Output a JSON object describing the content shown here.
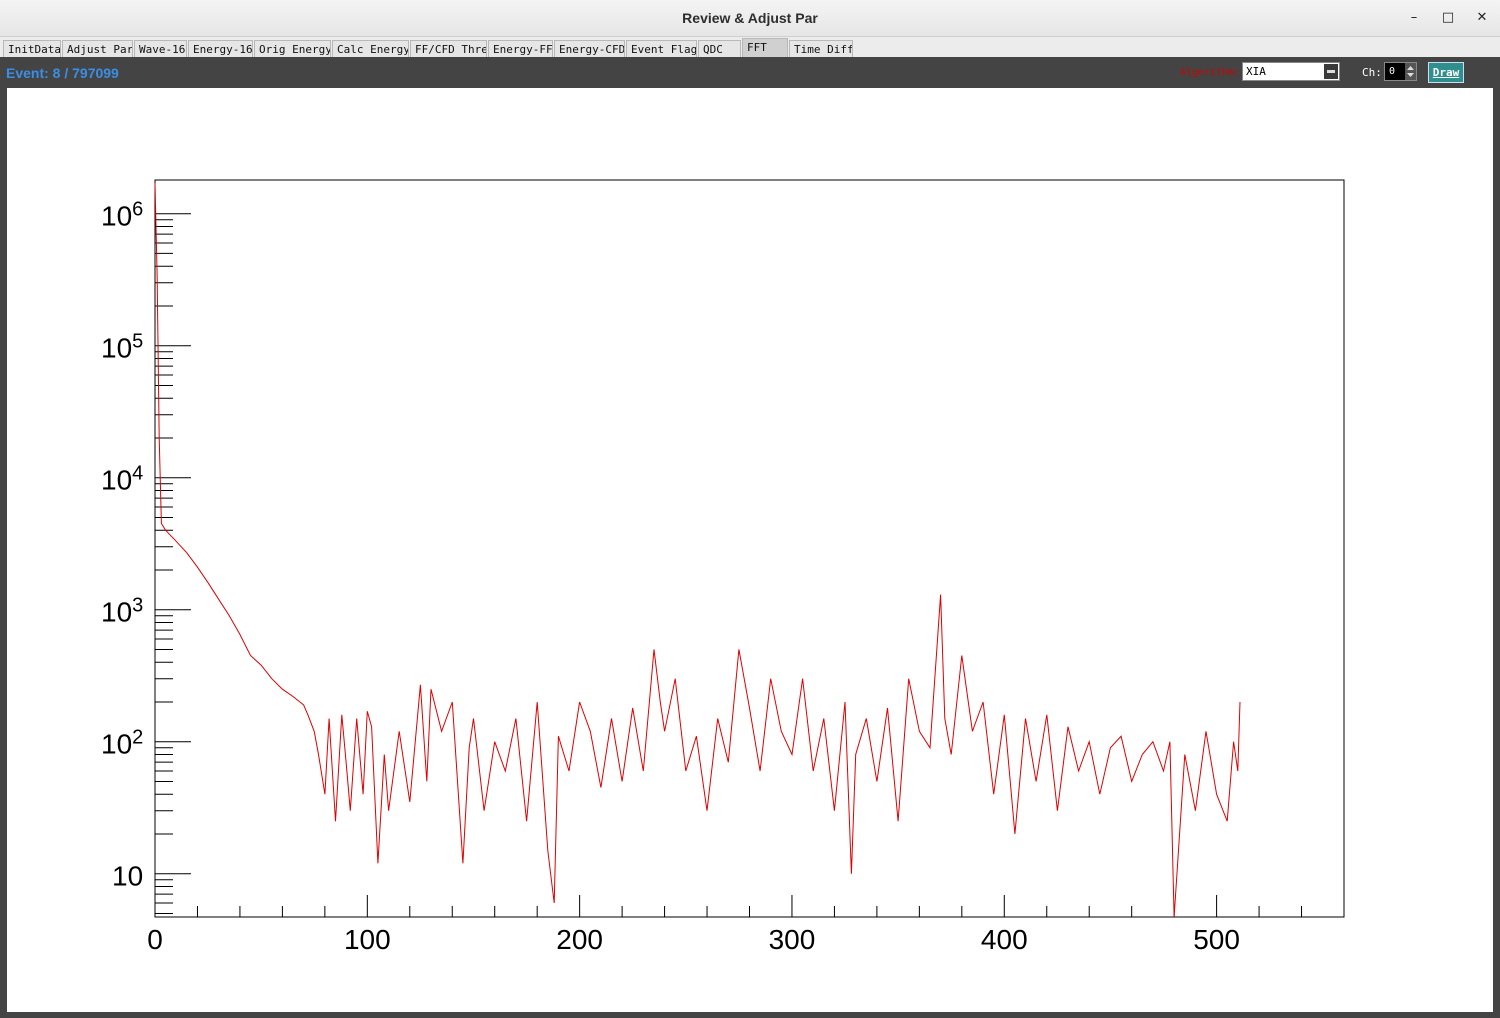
{
  "window": {
    "title": "Review & Adjust Par",
    "minimize": "–",
    "maximize": "□",
    "close": "✕"
  },
  "tabs": [
    {
      "label": "InitData"
    },
    {
      "label": "Adjust Par"
    },
    {
      "label": "Wave-16"
    },
    {
      "label": "Energy-16"
    },
    {
      "label": "Orig Energy"
    },
    {
      "label": "Calc Energy"
    },
    {
      "label": "FF/CFD Thre"
    },
    {
      "label": "Energy-FF"
    },
    {
      "label": "Energy-CFD"
    },
    {
      "label": "Event Flag"
    },
    {
      "label": "QDC"
    },
    {
      "label": "FFT",
      "active": true
    },
    {
      "label": "Time Diff"
    }
  ],
  "toolbar": {
    "event_text": "Event: 8 / 797099",
    "algorithm_label": "Algorithm:",
    "algorithm_value": "XIA",
    "ch_label": "Ch:",
    "ch_value": "0",
    "draw_label": "Draw"
  },
  "colors": {
    "line": "#e00000",
    "event_text": "#3a8ee6",
    "draw_button": "#2f8f8f",
    "panel": "#444444"
  },
  "chart_data": {
    "type": "line",
    "title": "",
    "xlabel": "",
    "ylabel": "",
    "xlim": [
      0,
      560
    ],
    "ylim": [
      4.7,
      1800000
    ],
    "yscale": "log",
    "grid": false,
    "x_ticks": [
      0,
      100,
      200,
      300,
      400,
      500
    ],
    "y_ticks": [
      {
        "value": 10,
        "base": "10",
        "exp": ""
      },
      {
        "value": 100,
        "base": "10",
        "exp": "2"
      },
      {
        "value": 1000,
        "base": "10",
        "exp": "3"
      },
      {
        "value": 10000,
        "base": "10",
        "exp": "4"
      },
      {
        "value": 100000,
        "base": "10",
        "exp": "5"
      },
      {
        "value": 1000000,
        "base": "10",
        "exp": "6"
      }
    ],
    "series": [
      {
        "color": "#e00000",
        "x": [
          0,
          1,
          2,
          3,
          5,
          10,
          15,
          20,
          25,
          30,
          35,
          40,
          45,
          50,
          55,
          60,
          65,
          70,
          72,
          75,
          77,
          80,
          82,
          85,
          88,
          90,
          92,
          95,
          98,
          100,
          102,
          105,
          108,
          110,
          115,
          120,
          125,
          128,
          130,
          135,
          140,
          145,
          148,
          150,
          155,
          160,
          165,
          170,
          175,
          180,
          185,
          188,
          190,
          195,
          200,
          205,
          210,
          215,
          220,
          225,
          230,
          235,
          238,
          240,
          245,
          250,
          255,
          260,
          265,
          270,
          275,
          280,
          285,
          290,
          295,
          300,
          305,
          310,
          315,
          320,
          325,
          328,
          330,
          335,
          340,
          345,
          350,
          355,
          360,
          365,
          370,
          372,
          375,
          380,
          385,
          390,
          395,
          400,
          405,
          410,
          415,
          420,
          425,
          430,
          435,
          440,
          445,
          450,
          455,
          460,
          465,
          470,
          475,
          478,
          480,
          485,
          490,
          495,
          500,
          505,
          508,
          510,
          511
        ],
        "y": [
          1700000,
          350000,
          20000,
          4500,
          4000,
          3300,
          2700,
          2100,
          1600,
          1200,
          900,
          650,
          450,
          380,
          300,
          250,
          220,
          190,
          160,
          120,
          80,
          40,
          150,
          25,
          160,
          70,
          30,
          150,
          40,
          170,
          130,
          12,
          80,
          30,
          120,
          35,
          270,
          50,
          250,
          120,
          200,
          12,
          90,
          150,
          30,
          100,
          60,
          150,
          25,
          200,
          15,
          6,
          110,
          60,
          200,
          120,
          45,
          150,
          50,
          180,
          60,
          500,
          200,
          120,
          300,
          60,
          110,
          30,
          150,
          70,
          500,
          180,
          60,
          300,
          120,
          80,
          300,
          60,
          150,
          30,
          200,
          10,
          80,
          150,
          50,
          180,
          25,
          300,
          120,
          90,
          1300,
          150,
          80,
          450,
          120,
          200,
          40,
          160,
          20,
          150,
          50,
          160,
          30,
          130,
          60,
          100,
          40,
          90,
          110,
          50,
          80,
          100,
          60,
          100,
          4.7,
          80,
          30,
          120,
          40,
          25,
          100,
          60,
          200
        ]
      }
    ]
  }
}
